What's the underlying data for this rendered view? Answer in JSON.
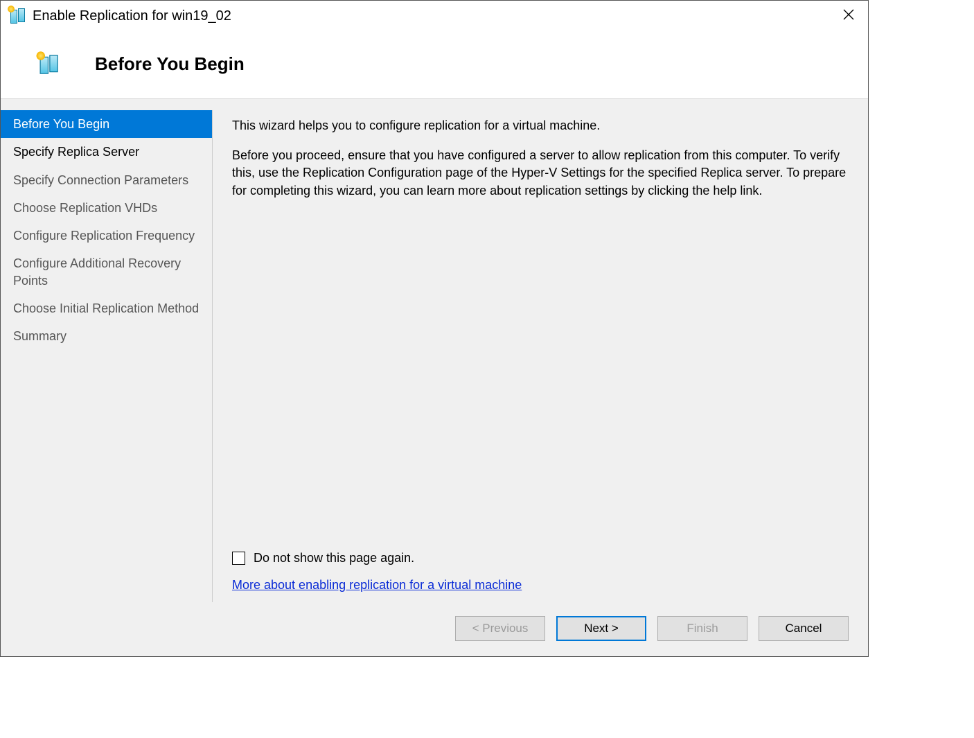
{
  "window": {
    "title": "Enable Replication for win19_02"
  },
  "header": {
    "title": "Before You Begin"
  },
  "sidebar": {
    "items": [
      {
        "label": "Before You Begin"
      },
      {
        "label": "Specify Replica Server"
      },
      {
        "label": "Specify Connection Parameters"
      },
      {
        "label": "Choose Replication VHDs"
      },
      {
        "label": "Configure Replication Frequency"
      },
      {
        "label": "Configure Additional Recovery Points"
      },
      {
        "label": "Choose Initial Replication Method"
      },
      {
        "label": "Summary"
      }
    ]
  },
  "content": {
    "para1": "This wizard helps you to configure replication for a virtual machine.",
    "para2": "Before you proceed, ensure that you have configured a server to allow replication from this computer. To verify this, use the Replication Configuration page of the Hyper-V Settings for the specified Replica server. To prepare for completing this wizard, you can learn more about replication settings by clicking the help link.",
    "checkbox_label": "Do not show this page again.",
    "help_link": "More about enabling replication for a virtual machine"
  },
  "buttons": {
    "previous": "< Previous",
    "next": "Next >",
    "finish": "Finish",
    "cancel": "Cancel"
  }
}
